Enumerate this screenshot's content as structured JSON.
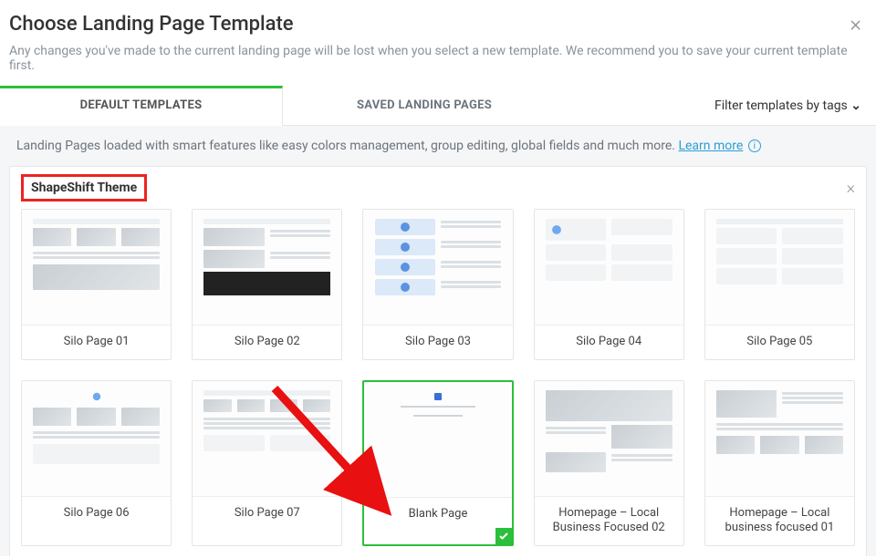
{
  "header": {
    "title": "Choose Landing Page Template"
  },
  "subtext": "Any changes you've made to the current landing page will be lost when you select a new template. We recommend you to save your current template first.",
  "tabs": {
    "default": "DEFAULT TEMPLATES",
    "saved": "SAVED LANDING PAGES"
  },
  "filter": {
    "label": "Filter templates by tags",
    "chevron": "⌄"
  },
  "section": {
    "description_pre": "Landing Pages loaded with smart features like easy colors management, group editing, global fields and much more. ",
    "learn_more": "Learn more",
    "theme_title": "ShapeShift Theme"
  },
  "templates": [
    {
      "label": "Silo Page 01"
    },
    {
      "label": "Silo Page 02"
    },
    {
      "label": "Silo Page 03"
    },
    {
      "label": "Silo Page 04"
    },
    {
      "label": "Silo Page 05"
    },
    {
      "label": "Silo Page 06"
    },
    {
      "label": "Silo Page 07"
    },
    {
      "label": "Blank Page",
      "selected": true
    },
    {
      "label": "Homepage – Local Business Focused 02"
    },
    {
      "label": "Homepage – Local business focused 01"
    }
  ]
}
